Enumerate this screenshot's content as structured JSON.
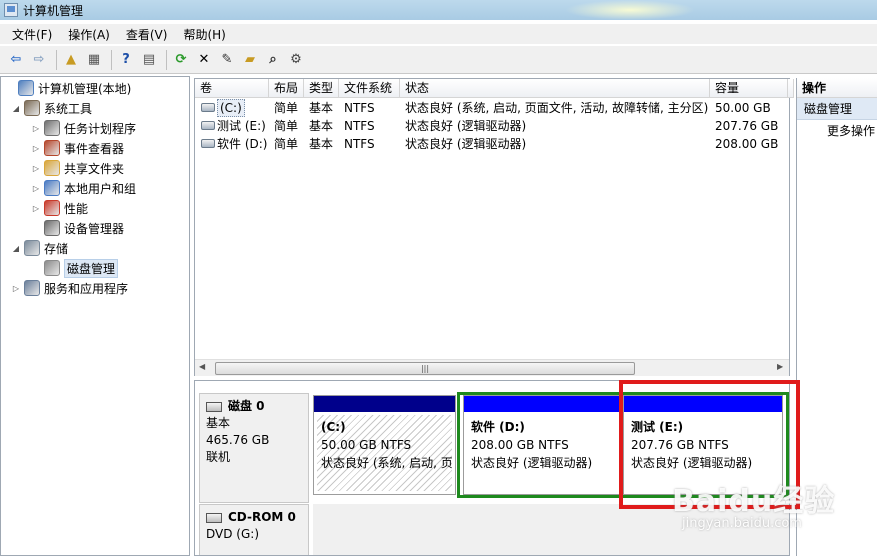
{
  "window": {
    "title": "计算机管理"
  },
  "menu": [
    "文件(F)",
    "操作(A)",
    "查看(V)",
    "帮助(H)"
  ],
  "toolbar": [
    {
      "name": "back-arrow-icon",
      "glyph": "⇦",
      "color": "#2d6cc8"
    },
    {
      "name": "forward-arrow-icon",
      "glyph": "⇨",
      "color": "#8aa3c2"
    },
    {
      "name": "up-folder-icon",
      "glyph": "▲",
      "color": "#c89b23"
    },
    {
      "name": "show-hide-tree-icon",
      "glyph": "▦",
      "color": "#555555"
    },
    {
      "name": "help-icon",
      "glyph": "?",
      "color": "#1d4fa8"
    },
    {
      "name": "show-hide-action-pane-icon",
      "glyph": "▤",
      "color": "#555555"
    },
    {
      "name": "refresh-icon",
      "glyph": "⟳",
      "color": "#2b9a2b"
    },
    {
      "name": "delete-icon",
      "glyph": "✕",
      "color": "#000000"
    },
    {
      "name": "properties-icon",
      "glyph": "✎",
      "color": "#333333"
    },
    {
      "name": "open-folder-icon",
      "glyph": "▰",
      "color": "#c89b23"
    },
    {
      "name": "search-icon",
      "glyph": "⌕",
      "color": "#333333"
    },
    {
      "name": "settings-icon",
      "glyph": "⚙",
      "color": "#444444"
    }
  ],
  "tree": [
    {
      "label": "计算机管理(本地)",
      "level": 0,
      "toggle": "",
      "icon": "computer-management-icon",
      "color": "#4f7fbf"
    },
    {
      "label": "系统工具",
      "level": 1,
      "toggle": "◢",
      "icon": "system-tools-icon",
      "color": "#7a6a55"
    },
    {
      "label": "任务计划程序",
      "level": 2,
      "toggle": "▷",
      "icon": "clock-icon",
      "color": "#6f6f6f"
    },
    {
      "label": "事件查看器",
      "level": 2,
      "toggle": "▷",
      "icon": "event-viewer-icon",
      "color": "#b5472c"
    },
    {
      "label": "共享文件夹",
      "level": 2,
      "toggle": "▷",
      "icon": "shared-folder-icon",
      "color": "#d9a63a"
    },
    {
      "label": "本地用户和组",
      "level": 2,
      "toggle": "▷",
      "icon": "users-icon",
      "color": "#4a7bc4"
    },
    {
      "label": "性能",
      "level": 2,
      "toggle": "▷",
      "icon": "performance-icon",
      "color": "#c83a2a"
    },
    {
      "label": "设备管理器",
      "level": 2,
      "toggle": "",
      "icon": "device-manager-icon",
      "color": "#6a6a6a"
    },
    {
      "label": "存储",
      "level": 1,
      "toggle": "◢",
      "icon": "storage-icon",
      "color": "#7a8a9a"
    },
    {
      "label": "磁盘管理",
      "level": 2,
      "toggle": "",
      "icon": "disk-management-icon",
      "color": "#8a8a8a",
      "selected": true
    },
    {
      "label": "服务和应用程序",
      "level": 1,
      "toggle": "▷",
      "icon": "services-icon",
      "color": "#6a7f9a"
    }
  ],
  "list": {
    "columns": [
      "卷",
      "布局",
      "类型",
      "文件系统",
      "状态",
      "容量",
      ""
    ],
    "rows": [
      [
        "(C:)",
        "简单",
        "基本",
        "NTFS",
        "状态良好 (系统, 启动, 页面文件, 活动, 故障转储, 主分区)",
        "50.00 GB"
      ],
      [
        "测试 (E:)",
        "简单",
        "基本",
        "NTFS",
        "状态良好 (逻辑驱动器)",
        "207.76 GB"
      ],
      [
        "软件 (D:)",
        "简单",
        "基本",
        "NTFS",
        "状态良好 (逻辑驱动器)",
        "208.00 GB"
      ]
    ],
    "scroll_grip": "|||"
  },
  "actions": {
    "header": "操作",
    "section": "磁盘管理",
    "more": "更多操作"
  },
  "disks": [
    {
      "name": "磁盘 0",
      "type": "基本",
      "size": "465.76 GB",
      "status": "联机"
    },
    {
      "name": "CD-ROM 0",
      "type": "DVD (G:)",
      "size": "",
      "status": ""
    }
  ],
  "partitions": [
    {
      "name": "(C:)",
      "size": "50.00 GB NTFS",
      "status": "状态良好 (系统, 启动, 页"
    },
    {
      "name": "软件  (D:)",
      "size": "208.00 GB NTFS",
      "status": "状态良好 (逻辑驱动器)"
    },
    {
      "name": "测试  (E:)",
      "size": "207.76 GB NTFS",
      "status": "状态良好 (逻辑驱动器)"
    }
  ],
  "watermark": {
    "logo": "Baidu经验",
    "url": "jingyan.baidu.com"
  },
  "colors": {
    "primary_partition_bar": "#00008b",
    "logical_partition_bar": "#0000ff",
    "highlight_green": "#1e8a1e",
    "highlight_red": "#e01b1b"
  }
}
